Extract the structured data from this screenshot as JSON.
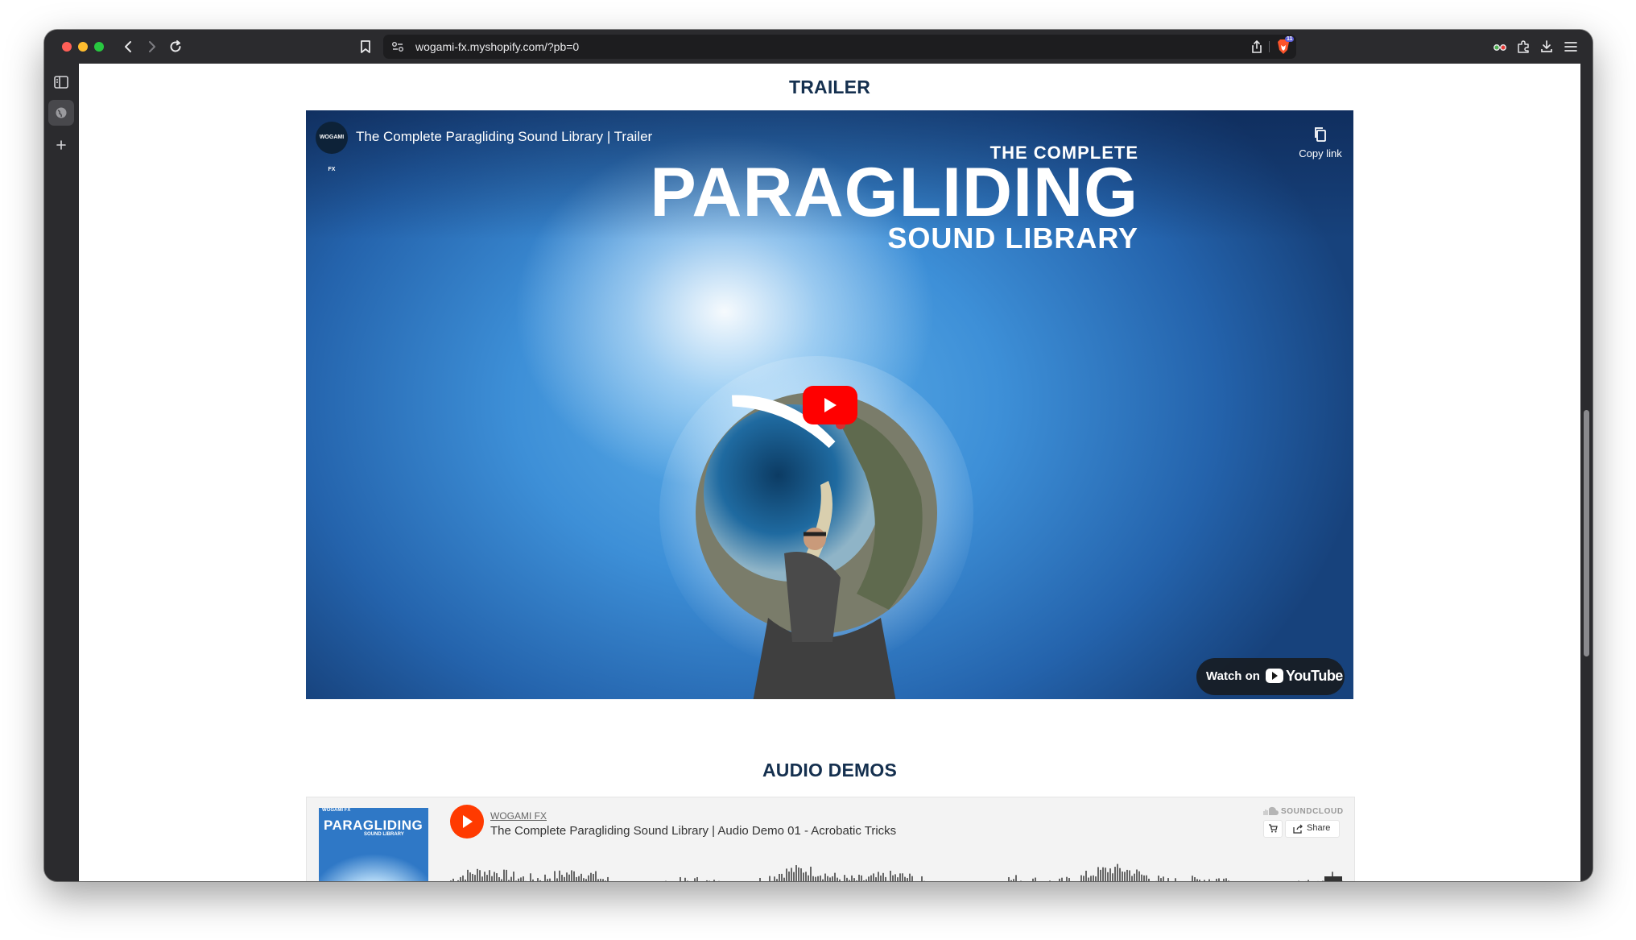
{
  "browser": {
    "url": "wogami-fx.myshopify.com/?pb=0",
    "shield_badge": "11"
  },
  "page": {
    "trailer_heading": "TRAILER",
    "audio_heading": "AUDIO DEMOS"
  },
  "video": {
    "channel_logo_text": "WOGAMI FX",
    "title": "The Complete Paragliding Sound Library | Trailer",
    "copy_link_label": "Copy link",
    "brand_the_complete": "THE COMPLETE",
    "brand_paragliding": "PARAGLIDING",
    "brand_sound_library": "SOUND LIBRARY",
    "watch_on_label": "Watch on",
    "youtube_label": "YouTube"
  },
  "soundcloud": {
    "artwork_top": "WOGAMI FX",
    "artwork_title": "PARAGLIDING",
    "artwork_subtitle": "SOUND LIBRARY",
    "user": "WOGAMI FX",
    "track_title": "The Complete Paragliding Sound Library | Audio Demo 01 - Acrobatic Tricks",
    "brand": "SOUNDCLOUD",
    "share_label": "Share"
  },
  "colors": {
    "heading": "#15304f",
    "youtube_red": "#ff0000",
    "soundcloud_orange": "#ff3a00"
  }
}
